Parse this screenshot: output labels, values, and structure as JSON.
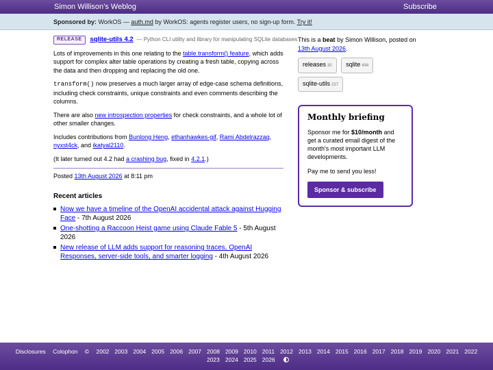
{
  "header": {
    "site_title": "Simon Willison’s Weblog",
    "subscribe": "Subscribe"
  },
  "sponsor": {
    "label": "Sponsored by:",
    "text1": "WorkOS —",
    "link1": "auth.md",
    "text2": "by WorkOS: agents register users, no sign-up form.",
    "link2": "Try it!"
  },
  "entry": {
    "badge": "RELEASE",
    "title": "sqlite-utils 4.2",
    "description": "— Python CLI utility and library for manipulating SQLite databases",
    "p1": {
      "before": "Lots of improvements in this one relating to the",
      "link": "table.transform() feature",
      "after": ", which adds support for complex alter table operations by creating a fresh table, copying across the data and then dropping and replacing the old one."
    },
    "p2": {
      "code": "transform()",
      "after": "now preserves a much larger array of edge-case schema definitions, including check constraints, unique constraints and even comments describing the columns."
    },
    "p3": {
      "before": "There are also",
      "link": "new introspection properties",
      "after": "for check constraints, and a whole lot of other smaller changes."
    },
    "p4": {
      "before": "Includes contributions from",
      "contributors": [
        "Bunlong Heng",
        "ethanhawkes-gif",
        "Rami Abdelrazzaq",
        "nyxst4ck",
        "ikatyal2110"
      ],
      "sep": ",",
      "and": ", and",
      "end": "."
    },
    "p5": {
      "before": "(It later turned out 4.2 had",
      "link1": "a crashing bug",
      "middle": ", fixed in",
      "link2": "4.2.1",
      "after": ".)"
    },
    "posted": {
      "label": "Posted",
      "date": "13th August 2026",
      "time": "at 8:11 pm"
    }
  },
  "recent": {
    "heading": "Recent articles",
    "items": [
      {
        "title": "Now we have a timeline of the OpenAI accidental attack against Hugging Face",
        "date": "- 7th August 2026"
      },
      {
        "title": "One-shotting a Raccoon Heist game using Claude Fable 5",
        "date": "- 5th August 2026"
      },
      {
        "title": "New release of LLM adds support for reasoning traces, OpenAI Responses, server-side tools, and smarter logging",
        "date": "- 4th August 2026"
      }
    ]
  },
  "sidebar": {
    "intro_before": "This is a",
    "intro_bold": "beat",
    "intro_mid": "by Simon Willison, posted on",
    "intro_date": "13th August 2026",
    "intro_end": ".",
    "tags": [
      {
        "name": "releases",
        "count": "30"
      },
      {
        "name": "sqlite",
        "count": "494"
      },
      {
        "name": "sqlite-utils",
        "count": "237"
      }
    ],
    "briefing": {
      "title": "Monthly briefing",
      "text_before": "Sponsor me for",
      "price": "$10/month",
      "text_after": "and get a curated email digest of the month's most important LLM developments.",
      "text2": "Pay me to send you less!",
      "button": "Sponsor & subscribe"
    }
  },
  "footer": {
    "links": [
      "Disclosures",
      "Colophon"
    ],
    "copyright": "©",
    "years_row1": [
      "2002",
      "2003",
      "2004",
      "2005",
      "2006",
      "2007",
      "2008",
      "2009",
      "2010",
      "2011",
      "2012",
      "2013",
      "2014",
      "2015",
      "2016",
      "2017",
      "2018",
      "2019",
      "2020",
      "2021",
      "2022"
    ],
    "years_row2": [
      "2023",
      "2024",
      "2025",
      "2026"
    ],
    "theme_icon": "theme-toggle-icon"
  }
}
